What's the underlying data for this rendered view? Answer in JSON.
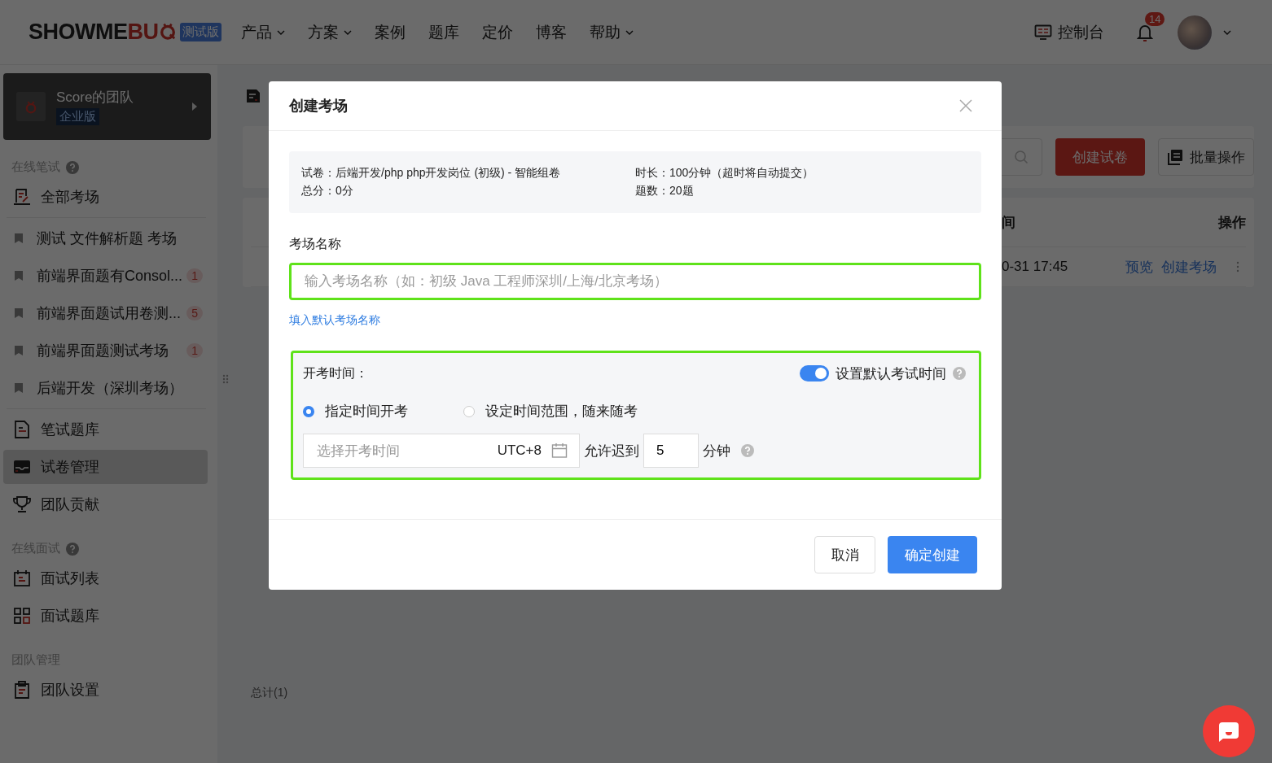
{
  "header": {
    "logo_dark": "SHOWME",
    "logo_accent": "BU",
    "badge": "测试版",
    "nav": [
      {
        "label": "产品",
        "dropdown": true
      },
      {
        "label": "方案",
        "dropdown": true
      },
      {
        "label": "案例",
        "dropdown": false
      },
      {
        "label": "题库",
        "dropdown": false
      },
      {
        "label": "定价",
        "dropdown": false
      },
      {
        "label": "博客",
        "dropdown": false
      },
      {
        "label": "帮助",
        "dropdown": true
      }
    ],
    "console": "控制台",
    "notifications": "14"
  },
  "sidebar": {
    "team": {
      "name": "Score的团队",
      "plan": "企业版"
    },
    "sections": [
      {
        "title": "在线笔试",
        "help": true,
        "items": [
          {
            "kind": "nav",
            "label": "全部考场",
            "selected": false
          },
          {
            "kind": "room",
            "label": "测试 文件解析题 考场",
            "selected": false
          },
          {
            "kind": "room",
            "label": "前端界面题有Consol...",
            "count": "1",
            "selected": false
          },
          {
            "kind": "room",
            "label": "前端界面题试用卷测...",
            "count": "5",
            "selected": false
          },
          {
            "kind": "room",
            "label": "前端界面题测试考场",
            "count": "1",
            "selected": false
          },
          {
            "kind": "room",
            "label": "后端开发（深圳考场）",
            "selected": false
          },
          {
            "kind": "nav",
            "label": "笔试题库",
            "selected": false
          },
          {
            "kind": "nav",
            "label": "试卷管理",
            "selected": true
          },
          {
            "kind": "nav",
            "label": "团队贡献",
            "selected": false
          }
        ]
      },
      {
        "title": "在线面试",
        "help": true,
        "items": [
          {
            "kind": "nav",
            "label": "面试列表",
            "selected": false
          },
          {
            "kind": "nav",
            "label": "面试题库",
            "selected": false
          }
        ]
      },
      {
        "title": "团队管理",
        "help": false,
        "items": [
          {
            "kind": "nav",
            "label": "团队设置",
            "selected": false
          }
        ]
      }
    ]
  },
  "main": {
    "create_button": "创建试卷",
    "batch_button": "批量操作",
    "table": {
      "columns": [
        "间",
        "操作"
      ],
      "rows": [
        {
          "time": "0-31 17:45",
          "actions": [
            "预览",
            "创建考场"
          ]
        }
      ]
    },
    "total": "总计(1)"
  },
  "dialog": {
    "title": "创建考场",
    "info": [
      "试卷：后端开发/php php开发岗位 (初级) - 智能组卷",
      "时长：100分钟（超时将自动提交）",
      "总分：0分",
      "题数：20题"
    ],
    "name_label": "考场名称",
    "name_field": {
      "placeholder": "输入考场名称（如：初级 Java 工程师深圳/上海/北京考场）"
    },
    "fill_default": "填入默认考场名称",
    "time": {
      "label": "开考时间：",
      "default_toggle": {
        "label": "设置默认考试时间",
        "on": true
      },
      "modes": [
        {
          "label": "指定时间开考",
          "selected": true
        },
        {
          "label": "设定时间范围，随来随考",
          "selected": false
        }
      ],
      "start_field": {
        "placeholder": "选择开考时间",
        "timezone": "UTC+8"
      },
      "late_label": "允许迟到",
      "late_value": "5",
      "late_unit": "分钟"
    },
    "buttons": {
      "cancel": "取消",
      "confirm": "确定创建"
    }
  }
}
